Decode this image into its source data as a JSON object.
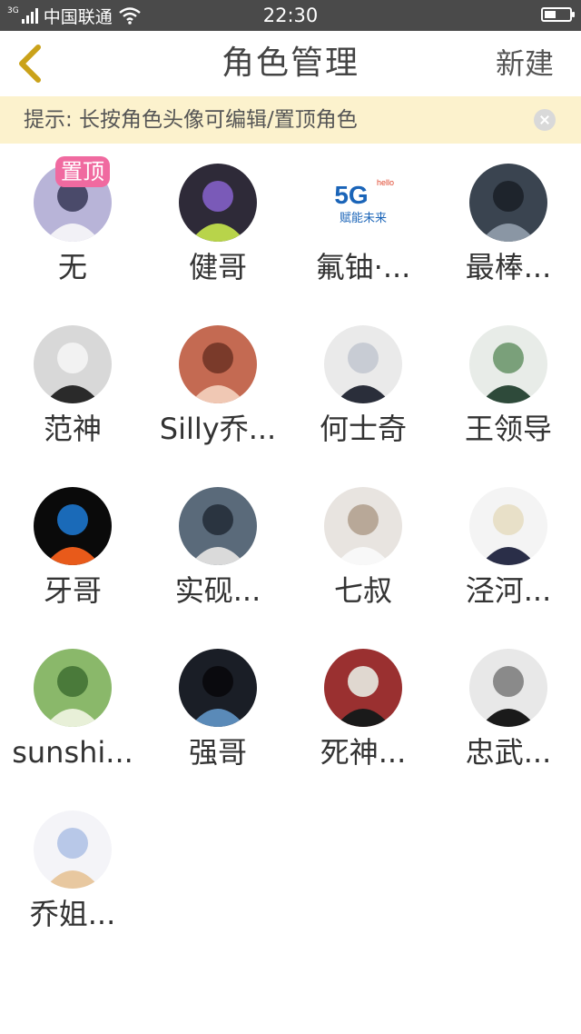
{
  "status_bar": {
    "network": "3G",
    "carrier": "中国联通",
    "time": "22:30"
  },
  "nav": {
    "title": "角色管理",
    "new_label": "新建"
  },
  "tip": {
    "text": "提示: 长按角色头像可编辑/置顶角色"
  },
  "roles": [
    {
      "name": "无",
      "pinned": true,
      "pin_label": "置顶",
      "colors": [
        "#b8b4d8",
        "#f2f1f6",
        "#4a4a6a"
      ]
    },
    {
      "name": "健哥",
      "colors": [
        "#2e2a38",
        "#b8d44a",
        "#7a5ab8"
      ]
    },
    {
      "name": "氟铀·...",
      "colors": [
        "#ffffff",
        "#1a64b8",
        "#e0462e"
      ],
      "logo": {
        "big": "5G",
        "small": "hello",
        "slogan": "赋能未来"
      }
    },
    {
      "name": "最棒...",
      "colors": [
        "#3a4450",
        "#8a96a4",
        "#1e242c"
      ]
    },
    {
      "name": "范神",
      "colors": [
        "#d8d8d8",
        "#2a2a2a",
        "#f2f2f2"
      ]
    },
    {
      "name": "Silly乔...",
      "colors": [
        "#c46a52",
        "#f0c8b4",
        "#7a3a2a"
      ]
    },
    {
      "name": "何士奇",
      "colors": [
        "#eaeaea",
        "#2a2e3a",
        "#c8ccd4"
      ]
    },
    {
      "name": "王领导",
      "colors": [
        "#e8ece8",
        "#2e4a3a",
        "#7aa07a"
      ]
    },
    {
      "name": "牙哥",
      "colors": [
        "#0a0a0a",
        "#e85a1a",
        "#1a6ab8"
      ]
    },
    {
      "name": "实砚...",
      "colors": [
        "#5a6a7a",
        "#dadada",
        "#2a3440"
      ]
    },
    {
      "name": "七叔",
      "colors": [
        "#e8e4e0",
        "#f8f8f8",
        "#b8a898"
      ]
    },
    {
      "name": "泾河...",
      "colors": [
        "#f4f4f4",
        "#2a2e48",
        "#e8e0c8"
      ]
    },
    {
      "name": "sunshi...",
      "colors": [
        "#8ab86a",
        "#e8f0d8",
        "#4a7a3a"
      ]
    },
    {
      "name": "强哥",
      "colors": [
        "#1a1e26",
        "#5a8ab8",
        "#0a0a0e"
      ]
    },
    {
      "name": "死神...",
      "colors": [
        "#9a3030",
        "#1a1a1a",
        "#e0d8d0"
      ]
    },
    {
      "name": "忠武...",
      "colors": [
        "#e8e8e8",
        "#1a1a1a",
        "#8a8a8a"
      ]
    },
    {
      "name": "乔姐...",
      "colors": [
        "#f4f4f8",
        "#e8c8a0",
        "#b8c8e8"
      ]
    }
  ]
}
